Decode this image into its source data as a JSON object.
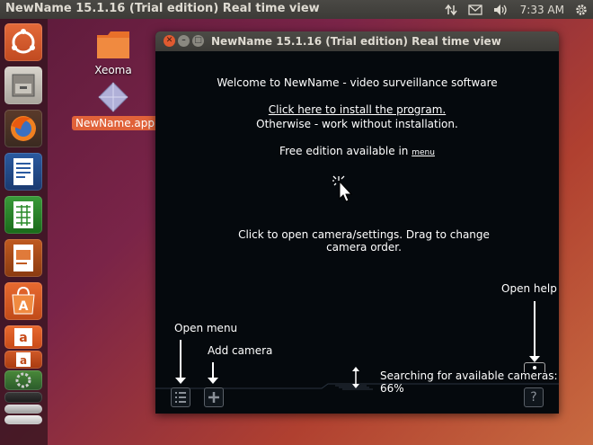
{
  "top_panel": {
    "title": "NewName 15.1.16 (Trial edition) Real time view",
    "clock": "7:33 AM",
    "icons": [
      "network-icon",
      "mail-icon",
      "volume-icon",
      "settings-gear-icon"
    ]
  },
  "desktop": {
    "icons": [
      {
        "label": "Xeoma"
      },
      {
        "label": "NewName.app"
      }
    ]
  },
  "window": {
    "title": "NewName 15.1.16 (Trial edition) Real time view",
    "welcome": "Welcome to NewName - video surveillance software",
    "install_link": "Click here to install the program.",
    "otherwise": "Otherwise - work without installation.",
    "free_edition": "Free edition available in",
    "menu_link": "menu",
    "click_hint_line1": "Click to open camera/settings. Drag to change",
    "click_hint_line2": "camera order.",
    "open_help": "Open help",
    "open_menu": "Open menu",
    "add_camera": "Add camera",
    "searching": "Searching for available cameras: 66%"
  },
  "colors": {
    "accent": "#e0623a",
    "window_bg": "#05090d",
    "panel_bg": "#3c3b37"
  }
}
